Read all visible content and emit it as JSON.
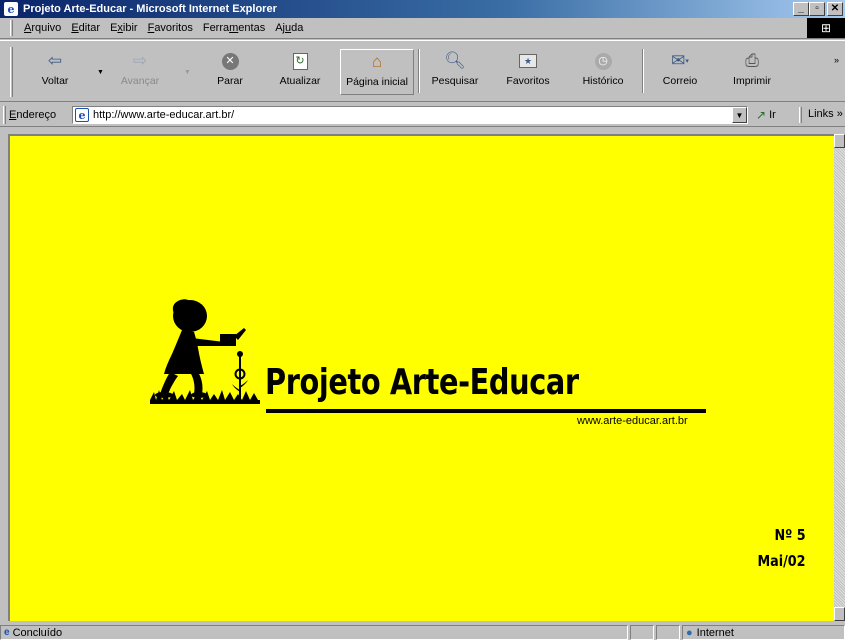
{
  "window": {
    "title": "Projeto Arte-Educar - Microsoft Internet Explorer"
  },
  "menu": {
    "items": [
      {
        "label": "Arquivo",
        "accel": "A",
        "rest": "rquivo"
      },
      {
        "label": "Editar",
        "accel": "E",
        "rest": "ditar"
      },
      {
        "label": "Exibir",
        "pre": "E",
        "accel": "x",
        "rest": "ibir"
      },
      {
        "label": "Favoritos",
        "accel": "F",
        "rest": "avoritos"
      },
      {
        "label": "Ferramentas",
        "pre": "Ferra",
        "accel": "m",
        "rest": "entas"
      },
      {
        "label": "Ajuda",
        "pre": "Aj",
        "accel": "u",
        "rest": "da"
      }
    ]
  },
  "toolbar": {
    "back": "Voltar",
    "forward": "Avançar",
    "stop": "Parar",
    "refresh": "Atualizar",
    "home": "Página inicial",
    "search": "Pesquisar",
    "favorites": "Favoritos",
    "history": "Histórico",
    "mail": "Correio",
    "print": "Imprimir"
  },
  "address": {
    "label": "Endereço",
    "url": "http://www.arte-educar.art.br/",
    "go": "Ir",
    "links": "Links"
  },
  "page": {
    "title": "Projeto Arte-Educar",
    "url": "www.arte-educar.art.br",
    "issue_number": "Nº 5",
    "issue_date": "Mai/02"
  },
  "status": {
    "text": "Concluído",
    "zone": "Internet"
  },
  "colors": {
    "page_background": "#ffff00",
    "chrome": "#c0c0c0",
    "titlebar": "#0a246a"
  }
}
